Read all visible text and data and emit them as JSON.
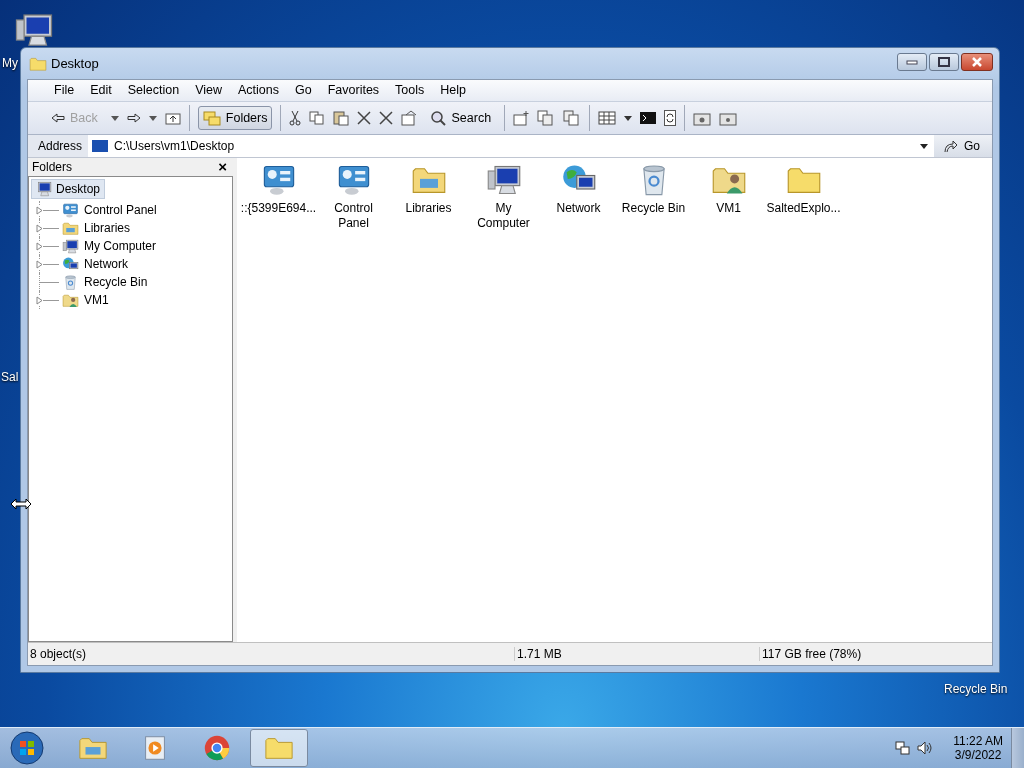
{
  "desktop_icons": [
    {
      "label": "My",
      "kind": "computer"
    },
    {
      "label": "Sal"
    },
    {
      "label": "Recycle Bin"
    }
  ],
  "window": {
    "title": "Desktop"
  },
  "menu": [
    "File",
    "Edit",
    "Selection",
    "View",
    "Actions",
    "Go",
    "Favorites",
    "Tools",
    "Help"
  ],
  "toolbar": {
    "back": {
      "label": "Back",
      "disabled": true
    },
    "folders": {
      "label": "Folders",
      "selected": true
    },
    "search": {
      "label": "Search"
    }
  },
  "address": {
    "label": "Address",
    "value": "C:\\Users\\vm1\\Desktop",
    "go": "Go"
  },
  "folders_pane": {
    "title": "Folders",
    "close": "×",
    "tree": [
      {
        "label": "Desktop",
        "kind": "desktop",
        "selected": true,
        "children": [
          {
            "label": "Control Panel",
            "kind": "control-panel",
            "selected": false,
            "expandable": true
          },
          {
            "label": "Libraries",
            "kind": "libraries",
            "selected": false,
            "expandable": true
          },
          {
            "label": "My Computer",
            "kind": "computer",
            "selected": false,
            "expandable": true
          },
          {
            "label": "Network",
            "kind": "network",
            "selected": false,
            "expandable": true
          },
          {
            "label": "Recycle Bin",
            "kind": "recycle",
            "selected": false,
            "expandable": false
          },
          {
            "label": "VM1",
            "kind": "user-folder",
            "selected": false,
            "expandable": true
          }
        ]
      }
    ]
  },
  "items": [
    {
      "label": "::{5399E694...",
      "kind": "control-panel"
    },
    {
      "label": "Control Panel",
      "kind": "control-panel"
    },
    {
      "label": "Libraries",
      "kind": "libraries"
    },
    {
      "label": "My Computer",
      "kind": "computer"
    },
    {
      "label": "Network",
      "kind": "network"
    },
    {
      "label": "Recycle Bin",
      "kind": "recycle"
    },
    {
      "label": "VM1",
      "kind": "user-folder"
    },
    {
      "label": "SaltedExplo...",
      "kind": "folder"
    }
  ],
  "status_bar": [
    "8 object(s)",
    "1.71 MB",
    "117 GB free (78%)"
  ],
  "taskbar": {
    "apps": [
      {
        "kind": "libraries",
        "selected": false
      },
      {
        "kind": "media",
        "selected": false
      },
      {
        "kind": "browser",
        "selected": false
      },
      {
        "kind": "folder",
        "selected": true
      }
    ],
    "time": "11:22 AM",
    "date": "3/9/2022"
  }
}
